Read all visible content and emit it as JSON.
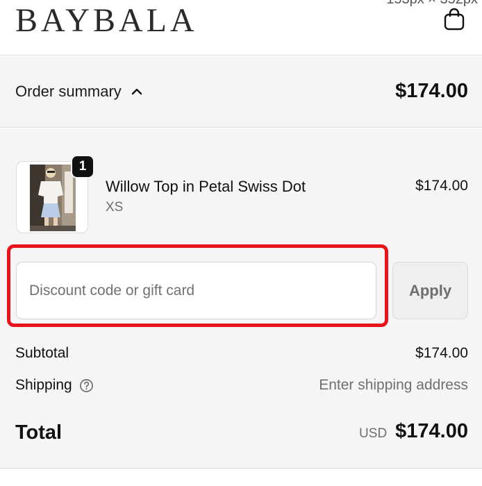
{
  "header": {
    "brand": "BAYBALA",
    "top_note": "153px × 352px",
    "cart_icon": "shopping-bag-icon"
  },
  "summary": {
    "toggle_label": "Order summary",
    "toggle_icon": "chevron-up-icon",
    "total": "$174.00"
  },
  "line_item": {
    "quantity": "1",
    "name": "Willow Top in Petal Swiss Dot",
    "variant": "XS",
    "price": "$174.00"
  },
  "discount": {
    "placeholder": "Discount code or gift card",
    "value": "",
    "apply_label": "Apply",
    "highlight_color": "#e8141c"
  },
  "totals": {
    "subtotal_label": "Subtotal",
    "subtotal_value": "$174.00",
    "shipping_label": "Shipping",
    "shipping_icon": "help-circle-icon",
    "shipping_value": "Enter shipping address",
    "total_label": "Total",
    "currency": "USD",
    "total_value": "$174.00"
  }
}
